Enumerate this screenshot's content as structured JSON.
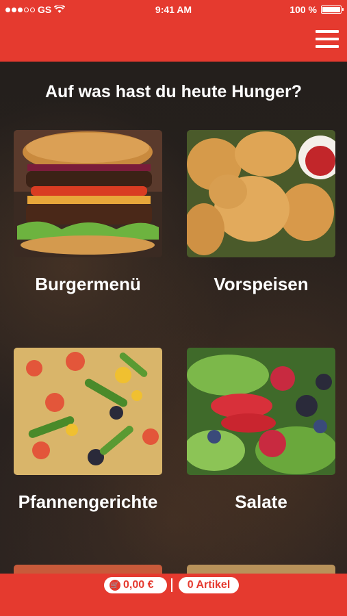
{
  "status_bar": {
    "carrier": "GS",
    "time": "9:41 AM",
    "battery": "100 %"
  },
  "header": {
    "menu_icon": "hamburger-menu-icon"
  },
  "main": {
    "title": "Auf was hast du heute Hunger?",
    "categories": [
      {
        "label": "Burgermenü",
        "image": "burger"
      },
      {
        "label": "Vorspeisen",
        "image": "nuggets"
      },
      {
        "label": "Pfannengerichte",
        "image": "pasta-salad"
      },
      {
        "label": "Salate",
        "image": "green-salad-berries"
      }
    ]
  },
  "bottom_bar": {
    "cart_icon": "cart-icon",
    "cart_total": "0,00 €",
    "item_count": "0 Artikel"
  },
  "colors": {
    "brand_red": "#e53a2f",
    "background": "#241f1c",
    "text": "#ffffff"
  }
}
